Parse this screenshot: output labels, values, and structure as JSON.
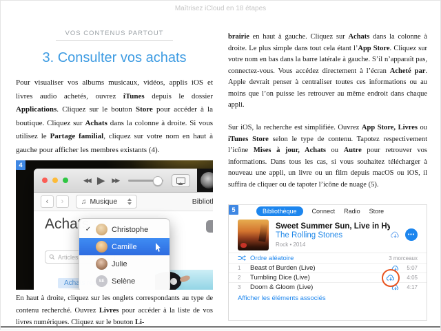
{
  "page": {
    "header": "Maîtrisez iCloud en 18 étapes"
  },
  "colors": {
    "accent_blue": "#1d86ee",
    "heading_blue": "#3d9be2",
    "selection_blue": "#2e6ce0",
    "annotation_orange": "#e8531f",
    "badge_blue": "#3e87e3"
  },
  "icons": {
    "check": "✓",
    "back_chevron": "‹",
    "forward_chevron": "›",
    "rewind": "◀◀",
    "play": "▶",
    "fast_forward": "▶▶",
    "music_note": "♫",
    "more_dots": "•••"
  },
  "left_column": {
    "kicker": "VOS CONTENUS PARTOUT",
    "title": "3. Consulter vos achats",
    "para1": [
      {
        "t": "Pour visualiser vos albums musicaux, vidéos, applis iOS et livres audio achetés, ouvrez "
      },
      {
        "t": "iTunes",
        "b": true
      },
      {
        "t": " depuis le dossier "
      },
      {
        "t": "Applications",
        "b": true
      },
      {
        "t": ". Cliquez sur le bouton "
      },
      {
        "t": "Store",
        "b": true
      },
      {
        "t": " pour accéder à la boutique. Cliquez sur "
      },
      {
        "t": "Achats",
        "b": true
      },
      {
        "t": " dans la colonne à droite. Si vous utilisez le "
      },
      {
        "t": "Partage familial",
        "b": true
      },
      {
        "t": ", cliquez sur votre nom en haut à gauche pour afficher les membres existants (4)."
      }
    ],
    "para2": [
      {
        "t": "En haut à droite, cliquez sur les onglets correspondants au type de contenu recherché. Ouvrez "
      },
      {
        "t": "Livres",
        "b": true
      },
      {
        "t": " pour accéder à la liste de vos livres numériques. Cliquez sur le bouton "
      },
      {
        "t": "Li-",
        "b": true
      }
    ]
  },
  "right_column": {
    "para1": [
      {
        "t": "brairie",
        "b": true
      },
      {
        "t": " en haut à gauche. Cliquez sur "
      },
      {
        "t": "Achats",
        "b": true
      },
      {
        "t": " dans la colonne à droite. Le plus simple dans tout cela étant l’"
      },
      {
        "t": "App Store",
        "b": true
      },
      {
        "t": ". Cliquez sur votre nom en bas dans la barre latérale à gauche. S’il n’apparaît pas, connectez-vous. Vous accédez directement à l’écran "
      },
      {
        "t": "Acheté par",
        "b": true
      },
      {
        "t": ". Apple devrait penser à centraliser toutes ces informations ou au moins que l’on puisse les retrouver au même endroit dans chaque appli."
      }
    ],
    "para2": [
      {
        "t": "Sur iOS, la recherche est simplifiée. Ouvrez "
      },
      {
        "t": "App Store, Livres",
        "b": true
      },
      {
        "t": " ou "
      },
      {
        "t": "iTunes Store",
        "b": true
      },
      {
        "t": " selon le type de contenu. Tapotez respectivement l’icône "
      },
      {
        "t": "Mises à jour, Achats",
        "b": true
      },
      {
        "t": " ou "
      },
      {
        "t": "Autre",
        "b": true
      },
      {
        "t": " pour retrouver vos informations. Dans tous les cas, si vous souhaitez télécharger à nouveau une appli, un livre ou un film depuis macOS ou iOS, il suffira de cliquer ou de tapoter l’icône de nuage (5)."
      }
    ]
  },
  "figure4": {
    "badge": "4",
    "window": {
      "media_selector": "Musique",
      "library_label": "Bibliothè",
      "heading": "Achats",
      "search_placeholder": "Articles acheté",
      "recent_tab": "Achats récents",
      "dropdown": {
        "items": [
          {
            "label": "Christophe",
            "checked": true
          },
          {
            "label": "Camille",
            "selected": true
          },
          {
            "label": "Julie"
          },
          {
            "label": "Selène",
            "initials": "SE"
          }
        ]
      }
    }
  },
  "figure5": {
    "badge": "5",
    "tabs": [
      {
        "label": "Bibliothèque",
        "active": true
      },
      {
        "label": "Connect"
      },
      {
        "label": "Radio"
      },
      {
        "label": "Store"
      }
    ],
    "album": {
      "title": "Sweet Summer Sun, Live in Hy...",
      "artist": "The Rolling Stones",
      "meta": "Rock • 2014"
    },
    "shuffle_label": "Ordre aléatoire",
    "count_label": "3 morceaux",
    "tracks": [
      {
        "num": "1",
        "title": "Beast of Burden (Live)",
        "time": "5:07"
      },
      {
        "num": "2",
        "title": "Tumbling Dice (Live)",
        "time": "4:05"
      },
      {
        "num": "3",
        "title": "Doom & Gloom (Live)",
        "time": "4:17"
      }
    ],
    "related_link": "Afficher les éléments associés"
  }
}
